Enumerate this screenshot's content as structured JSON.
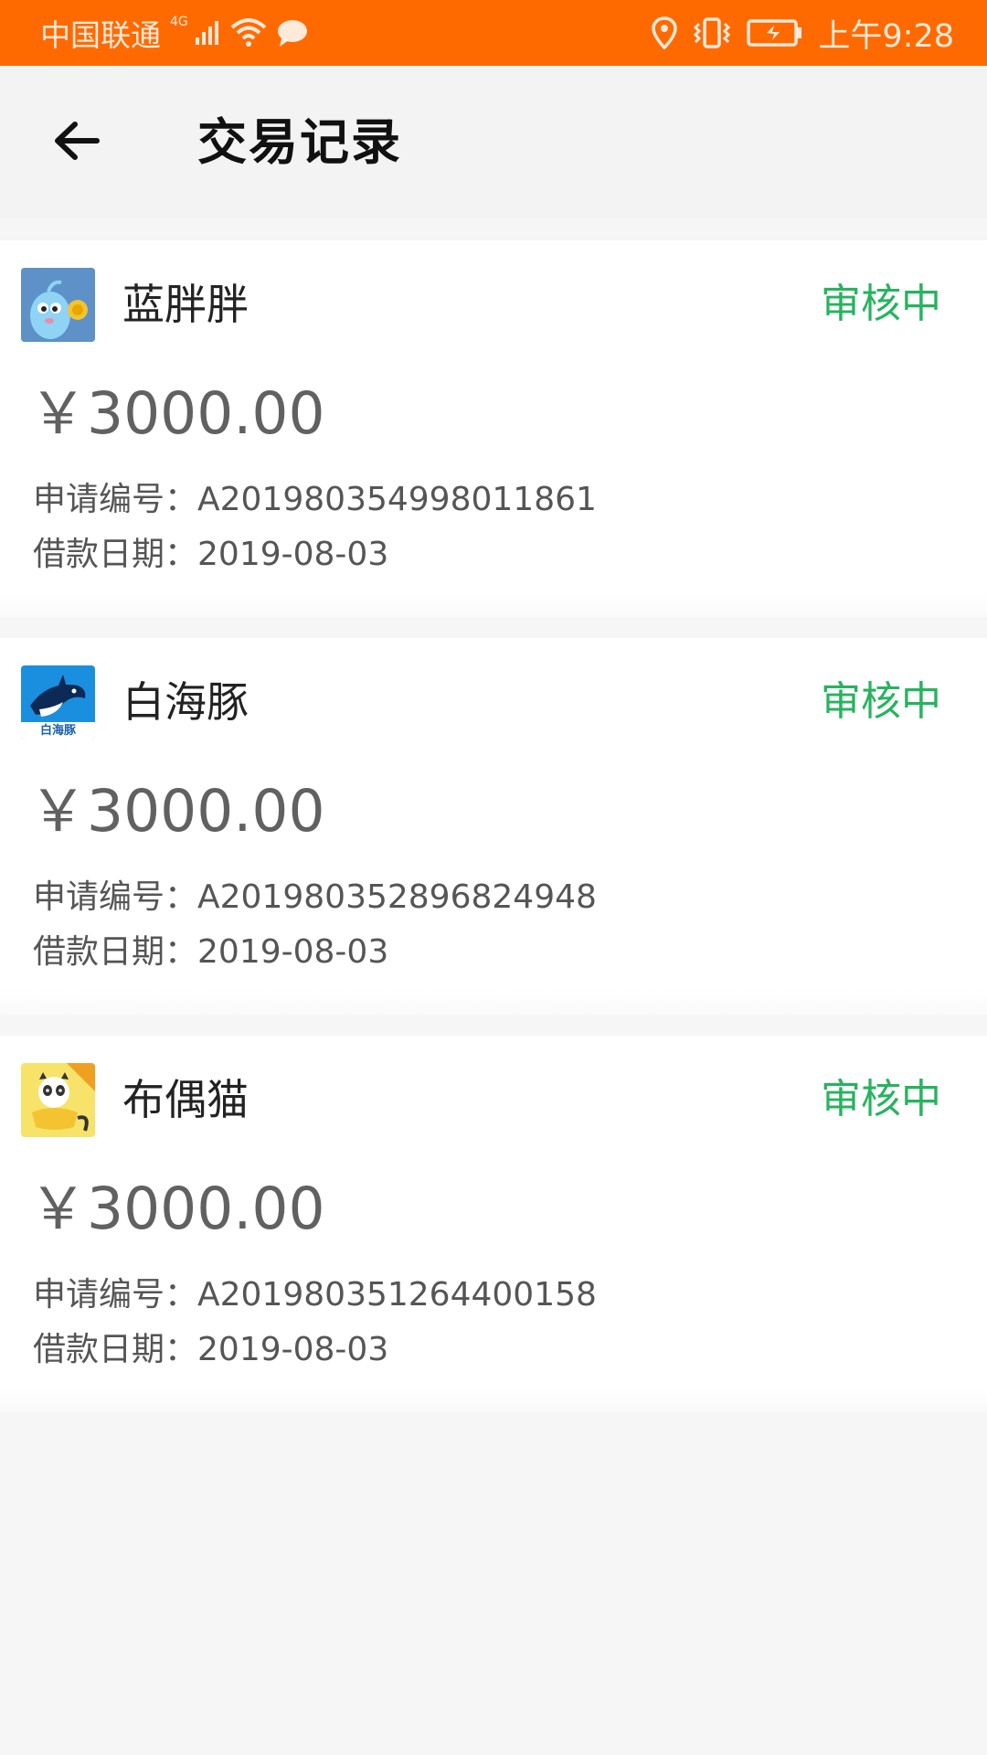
{
  "status_bar": {
    "carrier": "中国联通",
    "network": "4G",
    "time": "上午9:28",
    "bg_color": "#ff6a00",
    "icons": [
      "signal-icon",
      "wifi-icon",
      "message-icon",
      "location-icon",
      "vibrate-icon",
      "battery-icon"
    ]
  },
  "header": {
    "title": "交易记录",
    "back_icon": "arrow-left-icon"
  },
  "records": [
    {
      "name": "蓝胖胖",
      "status": "审核中",
      "amount": "￥3000.00",
      "app_no_label": "申请编号：",
      "app_no": "A201980354998011861",
      "date_label": "借款日期：",
      "date": "2019-08-03",
      "logo_icon": "blue-mascot-logo-icon"
    },
    {
      "name": "白海豚",
      "status": "审核中",
      "amount": "￥3000.00",
      "app_no_label": "申请编号：",
      "app_no": "A201980352896824948",
      "date_label": "借款日期：",
      "date": "2019-08-03",
      "logo_icon": "dolphin-logo-icon",
      "logo_text": "白海豚"
    },
    {
      "name": "布偶猫",
      "status": "审核中",
      "amount": "￥3000.00",
      "app_no_label": "申请编号：",
      "app_no": "A201980351264400158",
      "date_label": "借款日期：",
      "date": "2019-08-03",
      "logo_icon": "panda-cat-logo-icon"
    }
  ],
  "colors": {
    "status_green": "#27b35f",
    "accent_orange": "#ff6a00",
    "page_bg": "#f6f6f6"
  }
}
